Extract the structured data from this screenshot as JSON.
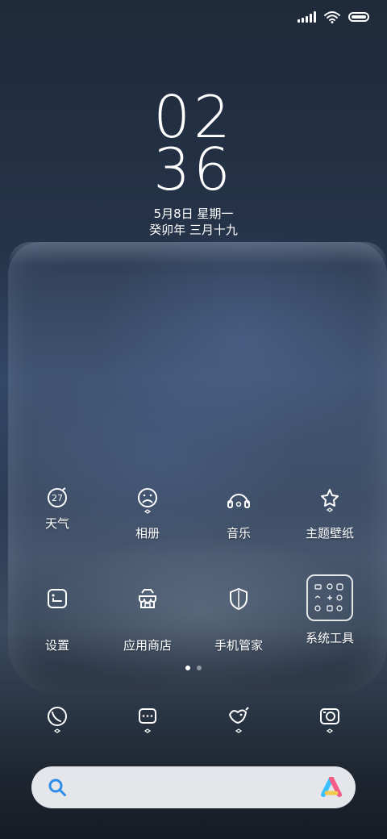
{
  "status_bar": {
    "icons": [
      "signal-icon",
      "wifi-icon",
      "battery-icon"
    ]
  },
  "clock": {
    "hours": "02",
    "minutes": "36"
  },
  "date": {
    "line1": "5月8日 星期一",
    "line2": "癸卯年 三月十九"
  },
  "apps_row1": [
    {
      "label": "天气",
      "icon": "weather-icon",
      "temp": "27"
    },
    {
      "label": "相册",
      "icon": "gallery-icon"
    },
    {
      "label": "音乐",
      "icon": "music-icon"
    },
    {
      "label": "主题壁纸",
      "icon": "themes-icon"
    }
  ],
  "apps_row2": [
    {
      "label": "设置",
      "icon": "settings-icon"
    },
    {
      "label": "应用商店",
      "icon": "app-store-icon"
    },
    {
      "label": "手机管家",
      "icon": "security-icon"
    },
    {
      "label": "系统工具",
      "icon": "system-tools-folder-icon"
    }
  ],
  "page_indicator": {
    "pages": 2,
    "active": 1
  },
  "dock": [
    {
      "icon": "phone-icon"
    },
    {
      "icon": "messages-icon"
    },
    {
      "icon": "browser-icon"
    },
    {
      "icon": "camera-icon"
    }
  ],
  "search_bar": {
    "icon": "search-icon",
    "assistant_icon": "assistant-logo-icon"
  },
  "colors": {
    "accent_search": "#2e8de8",
    "search_bg": "#eceef2"
  }
}
